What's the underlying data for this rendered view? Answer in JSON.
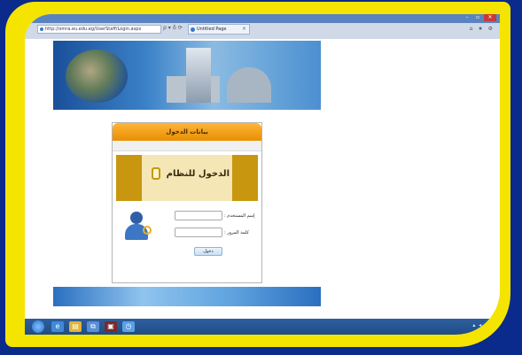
{
  "browser": {
    "address": "http://omra.eu.edu.eg/UserStaff/Login.aspx",
    "tab_title": "Untitled Page",
    "tab_close": "×",
    "nav_icons": "ρ ▾ ♁ ⟳",
    "tool_icons": "⌂ ★ ⚙",
    "window_buttons": [
      "–",
      "▫",
      "✕"
    ]
  },
  "login": {
    "header": "بيانات الدخول",
    "title": "الدخول للنظام",
    "username_label": "إسم المستخدم :",
    "password_label": "كلمة المرور :",
    "username_value": "",
    "password_value": "",
    "submit_label": "دخول"
  },
  "taskbar": {
    "items": [
      "e",
      "▤",
      "⧉",
      "▣",
      "◷"
    ],
    "tray": "▴ ◂ ♪"
  },
  "colors": {
    "frame": "#f5e400",
    "background": "#0a2a8c",
    "login_header": "#f2a10a",
    "banner_gold": "#c8960f"
  }
}
